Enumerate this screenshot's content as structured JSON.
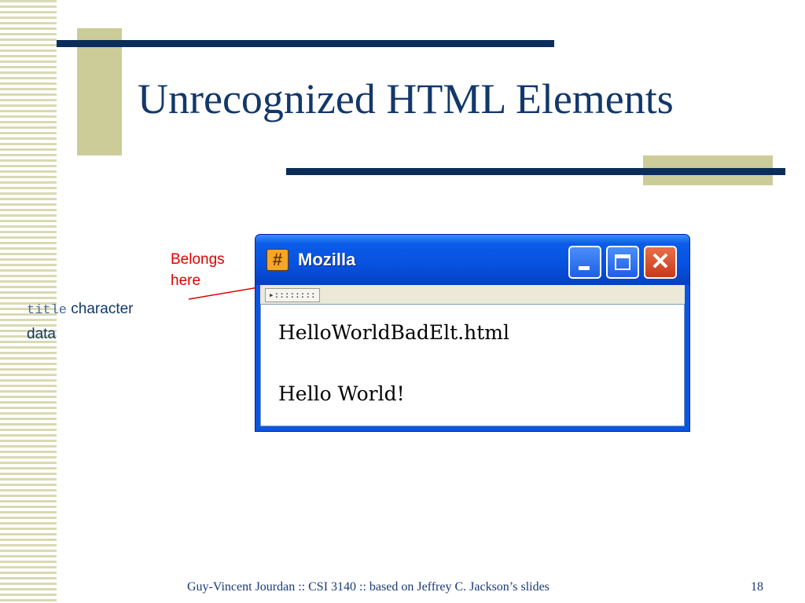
{
  "slide": {
    "title": "Unrecognized HTML Elements",
    "footer": "Guy-Vincent Jourdan :: CSI 3140 :: based on Jeffrey C. Jackson’s slides",
    "page_number": "18"
  },
  "annotations": {
    "belongs_line1": "Belongs",
    "belongs_line2": "here",
    "title_code": "title",
    "title_rest": " character",
    "title_line2": "data"
  },
  "browser_window": {
    "title": "Mozilla",
    "toolbar_grip": "▸::::::::",
    "content_line1": "HelloWorldBadElt.html",
    "content_line2": "Hello World!"
  },
  "colors": {
    "title": "#12386b",
    "annotation_red": "#e00000",
    "xp_blue": "#0a55e3",
    "deco_olive": "#cccc99"
  }
}
